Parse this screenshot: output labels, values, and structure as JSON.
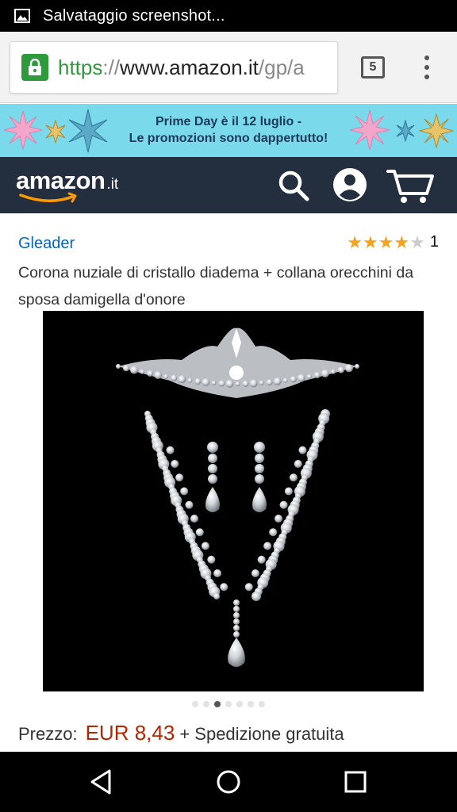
{
  "status_bar": {
    "notification_icon": "image-icon",
    "text": "Salvataggio screenshot..."
  },
  "browser": {
    "url_scheme": "https",
    "url_separator": "://",
    "url_host": "www.amazon.it",
    "url_path": "/gp/a",
    "tab_count": "5",
    "lock_icon": "lock-icon",
    "menu_icon": "more-vert-icon"
  },
  "promo": {
    "line1": "Prime Day è il 12 luglio -",
    "line2": "Le promozioni sono dappertutto!",
    "colors": {
      "background": "#7ad9ea",
      "text": "#1d3a5a"
    }
  },
  "header": {
    "logo_word": "amazon",
    "logo_tld": ".it",
    "search_icon": "search-icon",
    "account_icon": "account-icon",
    "cart_icon": "cart-icon",
    "colors": {
      "background": "#232f3e",
      "smile": "#ff9900"
    }
  },
  "product": {
    "brand": "Gleader",
    "rating": 4,
    "rating_max": 5,
    "review_count": "1",
    "title": "Corona nuziale di cristallo diadema + collana orecchini da sposa damigella d'onore",
    "image_alt": "tiara-necklace-earrings-set",
    "image_count": 7,
    "active_image_index": 2,
    "price_label": "Prezzo:",
    "price": "EUR 8,43",
    "shipping": "+ Spedizione gratuita",
    "colors": {
      "brand_link": "#0066c0",
      "price": "#b12704",
      "star": "#f4a41d"
    }
  },
  "nav_bar": {
    "back_icon": "back-icon",
    "home_icon": "home-icon",
    "recents_icon": "recents-icon"
  }
}
